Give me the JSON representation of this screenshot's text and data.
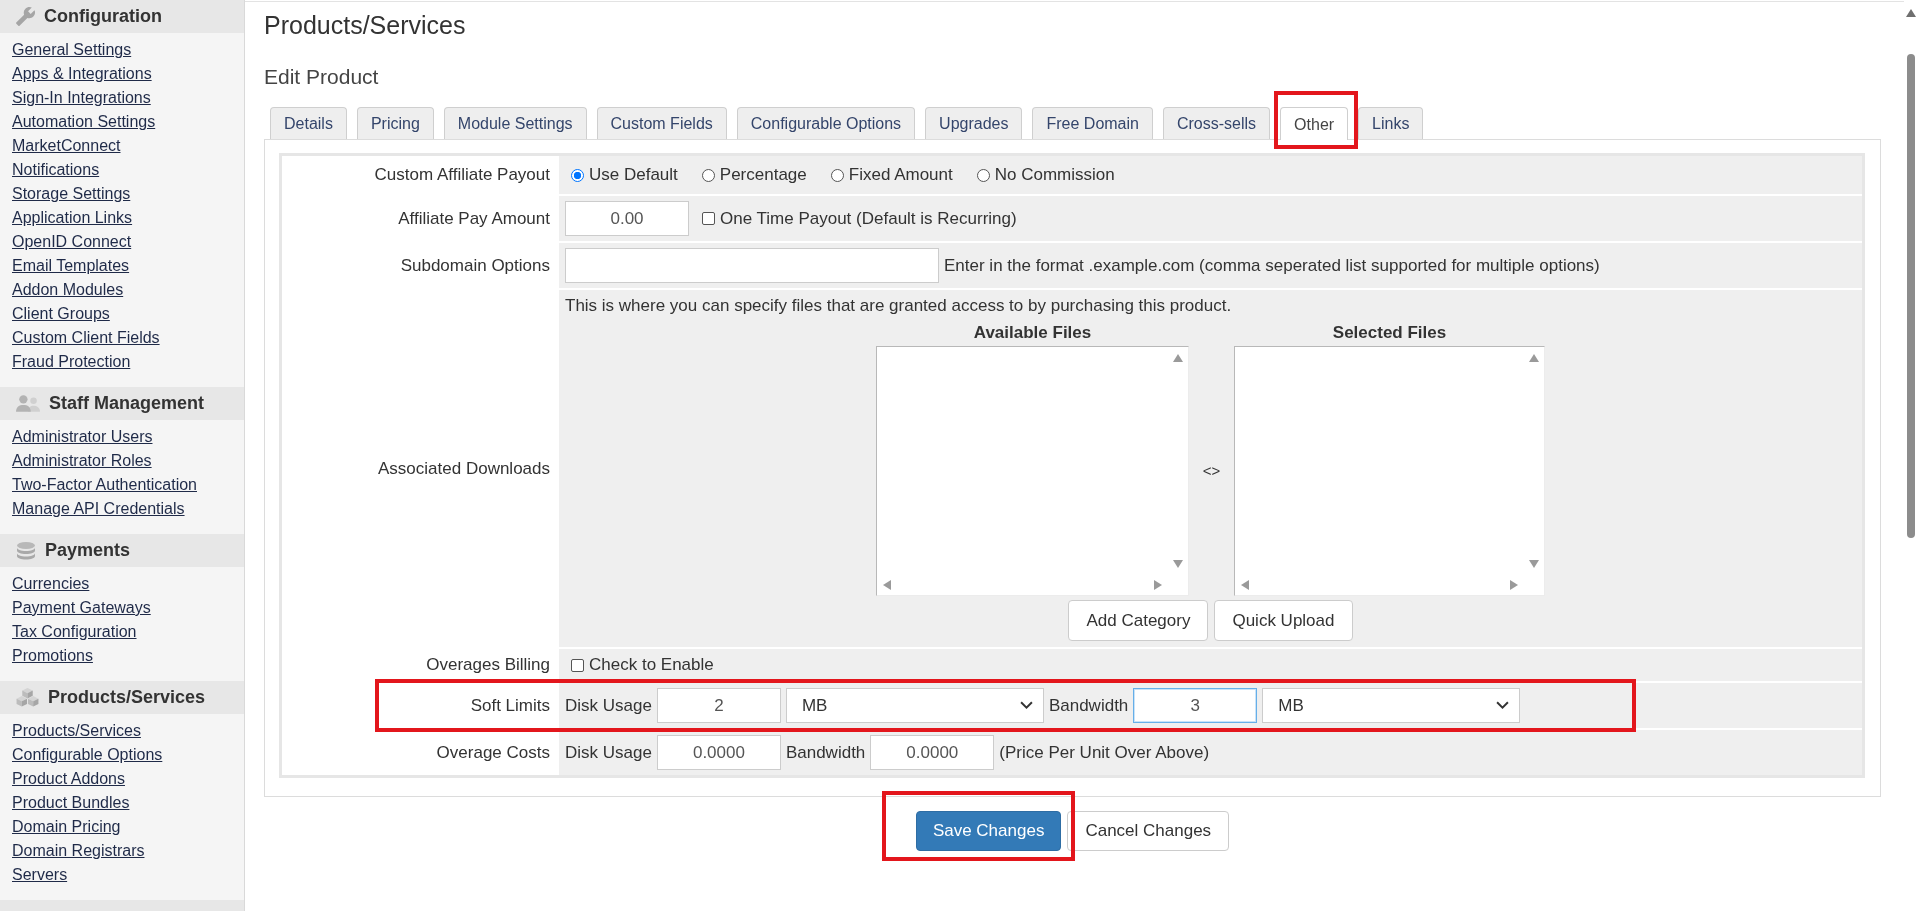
{
  "sidebar": {
    "sections": [
      {
        "title": "Configuration",
        "links": [
          "General Settings",
          "Apps & Integrations",
          "Sign-In Integrations",
          "Automation Settings",
          "MarketConnect",
          "Notifications",
          "Storage Settings",
          "Application Links",
          "OpenID Connect",
          "Email Templates",
          "Addon Modules",
          "Client Groups",
          "Custom Client Fields",
          "Fraud Protection"
        ]
      },
      {
        "title": "Staff Management",
        "links": [
          "Administrator Users",
          "Administrator Roles",
          "Two-Factor Authentication",
          "Manage API Credentials"
        ]
      },
      {
        "title": "Payments",
        "links": [
          "Currencies",
          "Payment Gateways",
          "Tax Configuration",
          "Promotions"
        ]
      },
      {
        "title": "Products/Services",
        "links": [
          "Products/Services",
          "Configurable Options",
          "Product Addons",
          "Product Bundles",
          "Domain Pricing",
          "Domain Registrars",
          "Servers"
        ]
      }
    ]
  },
  "page": {
    "title": "Products/Services",
    "subtitle": "Edit Product"
  },
  "tabs": [
    {
      "label": "Details",
      "selected": false,
      "highlighted": false
    },
    {
      "label": "Pricing",
      "selected": false,
      "highlighted": false
    },
    {
      "label": "Module Settings",
      "selected": false,
      "highlighted": false
    },
    {
      "label": "Custom Fields",
      "selected": false,
      "highlighted": false
    },
    {
      "label": "Configurable Options",
      "selected": false,
      "highlighted": false
    },
    {
      "label": "Upgrades",
      "selected": false,
      "highlighted": false
    },
    {
      "label": "Free Domain",
      "selected": false,
      "highlighted": false
    },
    {
      "label": "Cross-sells",
      "selected": false,
      "highlighted": false
    },
    {
      "label": "Other",
      "selected": true,
      "highlighted": true
    },
    {
      "label": "Links",
      "selected": false,
      "highlighted": false
    }
  ],
  "form": {
    "rows": [
      {
        "label": "Custom Affiliate Payout",
        "kind": "fields",
        "highlighted": false,
        "items": [
          {
            "kind": "radio",
            "label": "Use Default",
            "selected": true
          },
          {
            "kind": "radio",
            "label": "Percentage",
            "selected": false
          },
          {
            "kind": "radio",
            "label": "Fixed Amount",
            "selected": false
          },
          {
            "kind": "radio",
            "label": "No Commission",
            "selected": false
          }
        ]
      },
      {
        "label": "Affiliate Pay Amount",
        "kind": "fields",
        "highlighted": false,
        "items": [
          {
            "kind": "input",
            "value": "0.00",
            "focused": false
          },
          {
            "kind": "checkbox",
            "label": "One Time Payout (Default is Recurring)",
            "checked": false
          }
        ]
      },
      {
        "label": "Subdomain Options",
        "kind": "fields",
        "highlighted": false,
        "items": [
          {
            "kind": "textbox",
            "focused": false
          },
          {
            "kind": "hint",
            "text": "Enter in the format .example.com (comma seperated list supported for multiple options)"
          }
        ]
      },
      {
        "label": "Associated Downloads",
        "kind": "downloads",
        "highlighted": false,
        "description": "This is where you can specify files that are granted access to by purchasing this product.",
        "lists": [
          {
            "title": "Available Files"
          },
          {
            "title": "Selected Files"
          }
        ],
        "separator": "<>",
        "buttons": [
          "Add Category",
          "Quick Upload"
        ]
      },
      {
        "label": "Overages Billing",
        "kind": "fields",
        "highlighted": false,
        "items": [
          {
            "kind": "checkbox",
            "label": "Check to Enable",
            "checked": false
          }
        ]
      },
      {
        "label": "Soft Limits",
        "kind": "fields",
        "highlighted": true,
        "items": [
          {
            "kind": "text",
            "text": "Disk Usage"
          },
          {
            "kind": "input",
            "value": "2",
            "focused": false
          },
          {
            "kind": "select",
            "value": "MB"
          },
          {
            "kind": "text",
            "text": "Bandwidth"
          },
          {
            "kind": "input",
            "value": "3",
            "focused": true
          },
          {
            "kind": "select",
            "value": "MB"
          }
        ]
      },
      {
        "label": "Overage Costs",
        "kind": "fields",
        "highlighted": false,
        "items": [
          {
            "kind": "text",
            "text": "Disk Usage"
          },
          {
            "kind": "input",
            "value": "0.0000",
            "focused": false
          },
          {
            "kind": "text",
            "text": "Bandwidth"
          },
          {
            "kind": "input",
            "value": "0.0000",
            "focused": false
          },
          {
            "kind": "hint",
            "text": "(Price Per Unit Over Above)"
          }
        ]
      }
    ]
  },
  "actions": [
    {
      "label": "Save Changes",
      "kind": "primary",
      "highlighted": true
    },
    {
      "label": "Cancel Changes",
      "kind": "default",
      "highlighted": false
    }
  ]
}
